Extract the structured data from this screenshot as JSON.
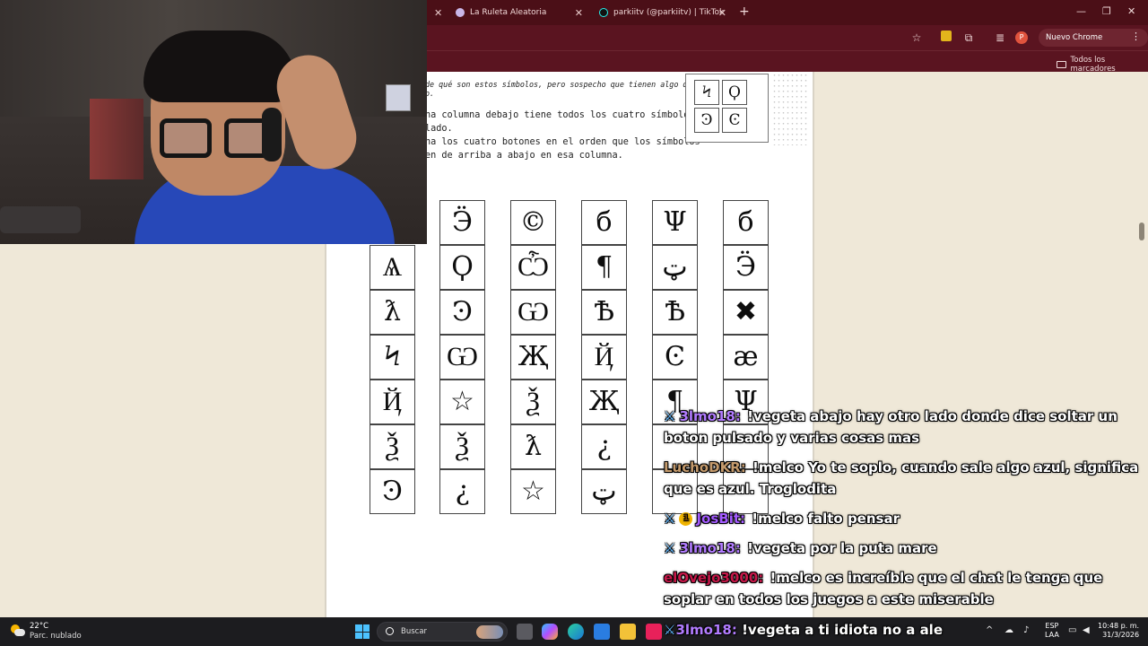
{
  "browser": {
    "tabs": [
      {
        "label": "La Ruleta Aleatoria"
      },
      {
        "label": "parkiitv (@parkiitv) | TikTok"
      }
    ],
    "update_button": "Nuevo Chrome disponible",
    "profile_initial": "P",
    "bookmarks_all": "Todos los marcadores"
  },
  "document": {
    "lines": [
      "de qué son estos símbolos, pero sospecho que tienen algo que ver",
      "o.",
      "na columna debajo tiene todos los cuatro símbolos",
      "lado.",
      "na los cuatro botones en el orden que los símbolos",
      "en de arriba a abajo en esa columna."
    ],
    "sample_symbols": [
      "Ϟ",
      "Ϙ",
      "Ͽ",
      "Ͼ"
    ],
    "columns": [
      [
        "Ѧ",
        "ƛ",
        "Ϟ",
        "Ҋ",
        "Ѯ",
        "Ͽ"
      ],
      [
        "Ӭ",
        "Ϙ",
        "Ͽ",
        "Ѡ",
        "☆",
        "Ѯ",
        "¿"
      ],
      [
        "©",
        "Ѽ",
        "Ѡ",
        "Җ",
        "Ѯ",
        "ƛ",
        "☆"
      ],
      [
        "б",
        "¶",
        "Ѣ",
        "Ҋ",
        "Җ",
        "¿",
        "ټ"
      ],
      [
        "Ψ",
        "ټ",
        "Ѣ",
        "Ͼ",
        "¶"
      ],
      [
        "б",
        "Ӭ",
        "✖",
        "æ",
        "Ψ"
      ]
    ]
  },
  "chat": [
    {
      "badges": [
        "sword"
      ],
      "user": "3lmo18:",
      "user_color": "#b27cff",
      "text": "!vegeta abajo hay otro lado donde dice soltar un boton pulsado y varias cosas mas"
    },
    {
      "badges": [],
      "user": "LuchoDKR:",
      "user_color": "#c49a6c",
      "text": "!melco Yo te soplo, cuando sale algo azul, significa que es azul. Troglodita"
    },
    {
      "badges": [
        "sword",
        "coin"
      ],
      "user": "JosBit:",
      "user_color": "#a45cff",
      "text": "!melco falto pensar"
    },
    {
      "badges": [
        "sword"
      ],
      "user": "3lmo18:",
      "user_color": "#b27cff",
      "text": "!vegeta por la puta mare"
    },
    {
      "badges": [],
      "user": "elOvejo3000:",
      "user_color": "#c8184a",
      "text": "!melco es increíble que el chat le tenga que soplar en todos los juegos a este miserable"
    },
    {
      "badges": [
        "sword"
      ],
      "user": "3lmo18:",
      "user_color": "#b27cff",
      "text": "!vegeta a ti idiota no a ale"
    }
  ],
  "taskbar": {
    "temperature": "22°C",
    "weather": "Parc. nublado",
    "search_placeholder": "Buscar",
    "lang_top": "ESP",
    "lang_bottom": "LAA",
    "time": "10:48 p. m.",
    "date": "31/3/2026"
  },
  "colors": {
    "tabbar": "#4b0f17",
    "toolbar": "#5a1420",
    "paper": "#efe8d8",
    "taskbar": "#1c1c1f"
  }
}
